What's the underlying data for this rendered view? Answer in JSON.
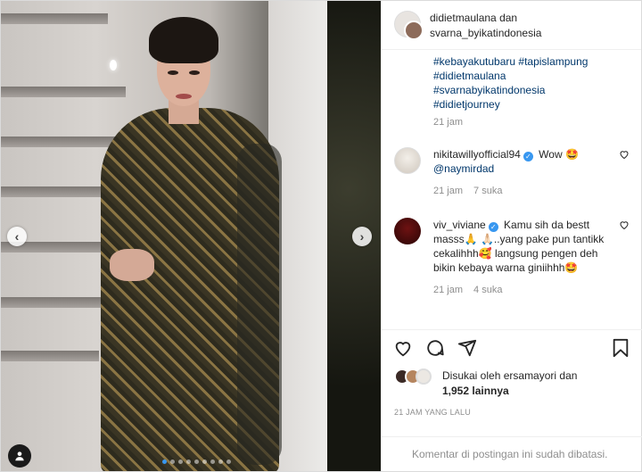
{
  "post": {
    "author": "didietmaulana",
    "and_text": "dan",
    "coauthor": "svarna_byikatindonesia",
    "hashtags": [
      "#kebayakutubaru #tapislampung",
      "#didietmaulana",
      "#svarnabyikatindonesia",
      "#didietjourney"
    ],
    "caption_time": "21 jam"
  },
  "comments": [
    {
      "user": "nikitawillyofficial94",
      "verified": true,
      "text": "Wow 🤩",
      "line2": "@naymirdad",
      "time": "21 jam",
      "likes": "7 suka"
    },
    {
      "user": "viv_viviane",
      "verified": true,
      "text": "Kamu sih da bestt masss🙏 🙏🏻..yang pake pun tantikk cekalihhh🥰 langsung pengen deh bikin kebaya warna giniihhh🤩",
      "time": "21 jam",
      "likes": "4 suka"
    }
  ],
  "likes_summary": {
    "prefix": "Disukai oleh",
    "user": "ersamayori",
    "mid": "dan",
    "count": "1,952 lainnya"
  },
  "posted_ago": "21 JAM YANG LALU",
  "comment_footer": "Komentar di postingan ini sudah dibatasi.",
  "carousel": {
    "total_slides": 9,
    "active_index": 0
  },
  "icons": {
    "like": "heart-icon",
    "comment": "comment-icon",
    "share": "share-icon",
    "save": "bookmark-icon",
    "prev": "chevron-left-icon",
    "next": "chevron-right-icon",
    "tag": "user-tag-icon"
  },
  "colors": {
    "link": "#00376b",
    "secondary": "#8e8e8e",
    "verified": "#3897f0",
    "border": "#dbdbdb"
  }
}
